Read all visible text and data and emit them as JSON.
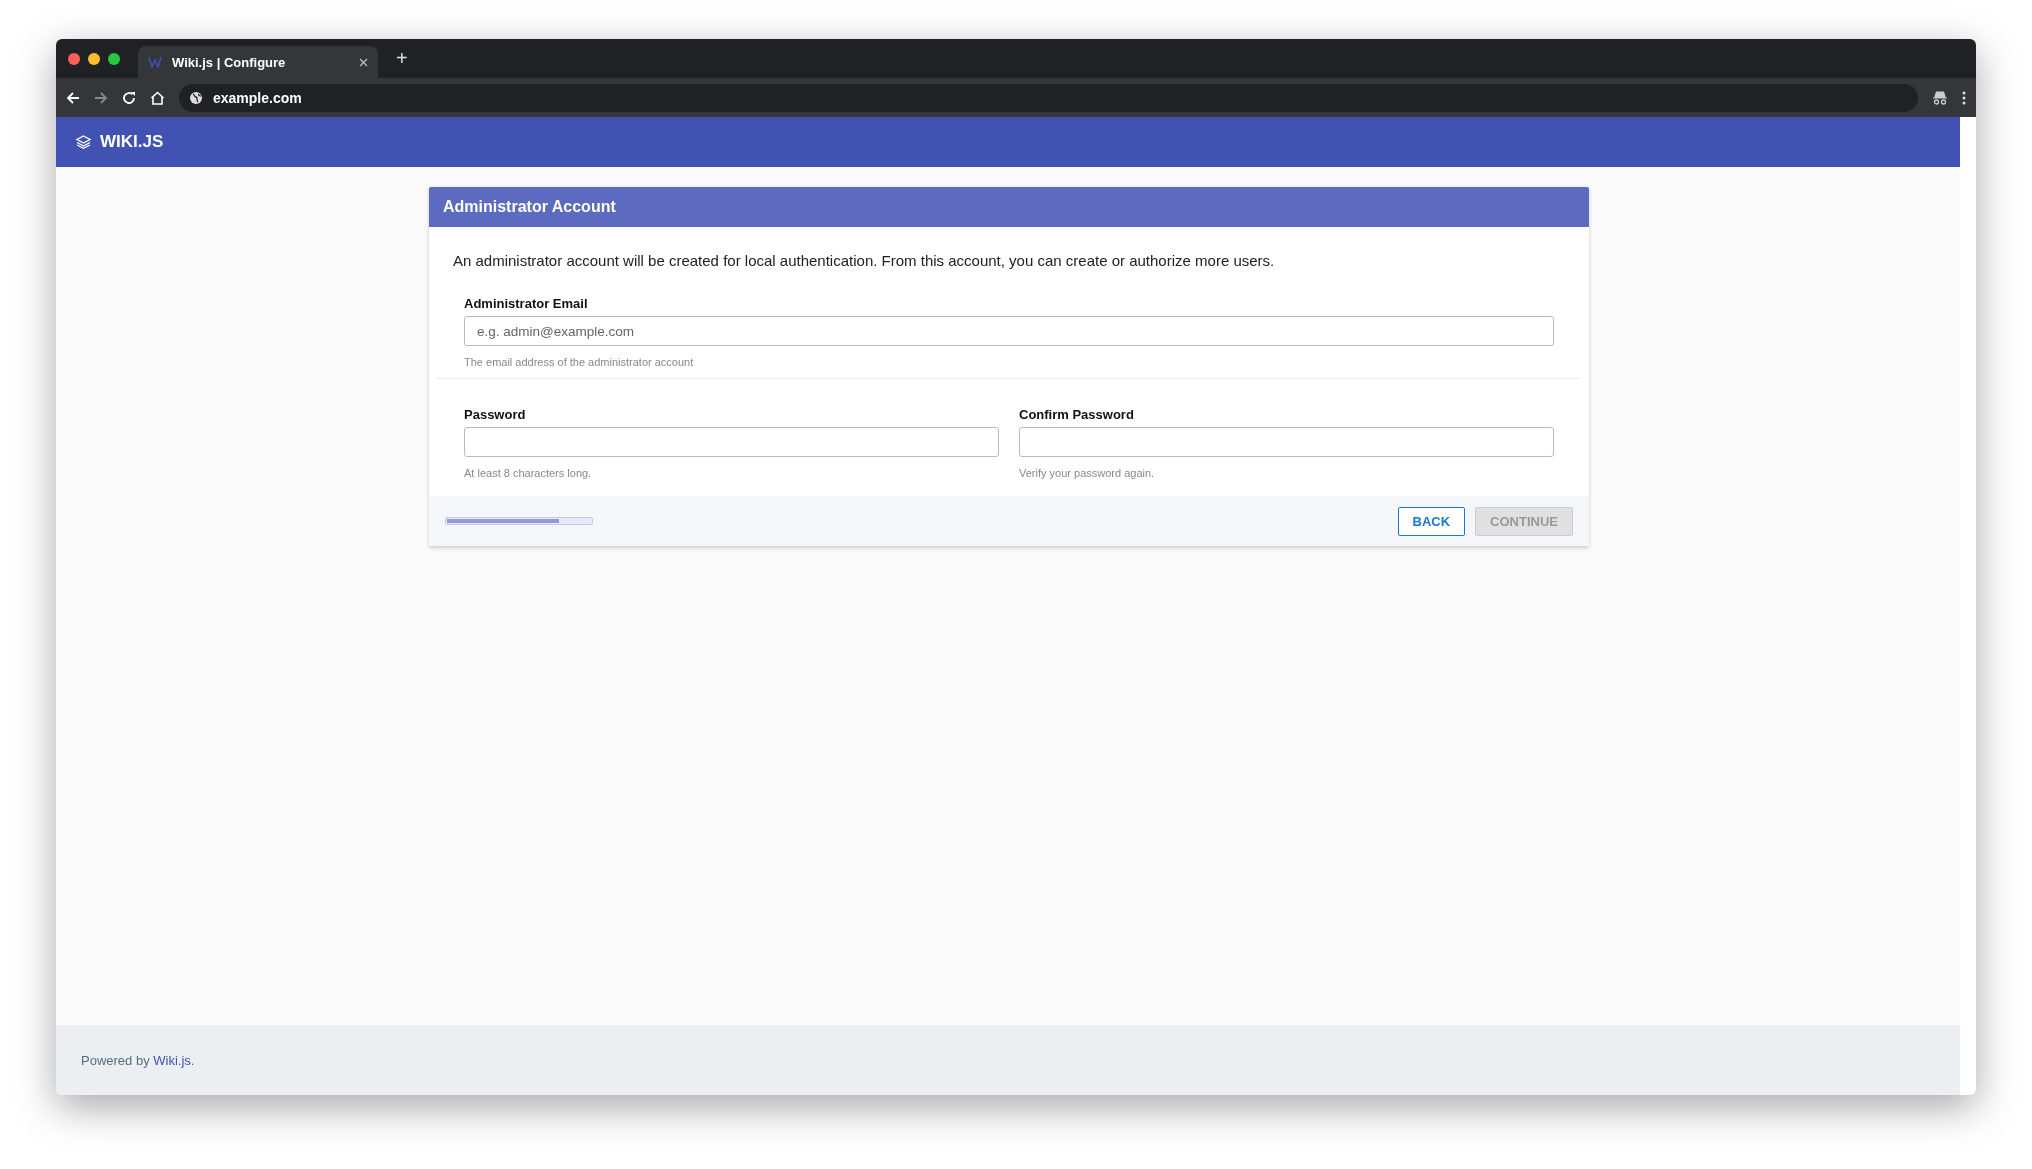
{
  "browser": {
    "tab": {
      "title": "Wiki.js | Configure",
      "selected": true
    },
    "new_tab": "+",
    "address": "example.com"
  },
  "app_bar": {
    "logo": "WIKI.JS"
  },
  "card": {
    "title": "Administrator Account",
    "intro": "An administrator account will be created for local authentication. From this account, you can create or authorize more users.",
    "email": {
      "label": "Administrator Email",
      "placeholder": "e.g. admin@example.com",
      "hint": "The email address of the administrator account"
    },
    "password": {
      "label": "Password",
      "hint": "At least 8 characters long."
    },
    "confirm": {
      "label": "Confirm Password",
      "hint": "Verify your password again."
    },
    "progress": {
      "level": 0.78
    },
    "buttons": [
      {
        "label": "BACK",
        "disabled": false
      },
      {
        "label": "CONTINUE",
        "disabled": true
      }
    ]
  },
  "footer": {
    "prefix": "Powered by",
    "link": "Wiki.js",
    "suffix": "."
  }
}
